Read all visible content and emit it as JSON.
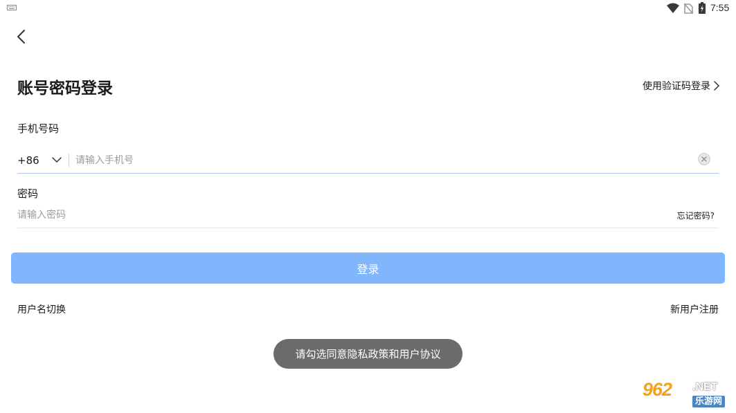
{
  "status_bar": {
    "time": "7:55",
    "icons": [
      "keyboard-icon",
      "wifi-icon",
      "no-sim-icon",
      "battery-charging-icon"
    ]
  },
  "header": {
    "back_icon": "chevron-left-icon",
    "title": "账号密码登录",
    "switch_label": "使用验证码登录"
  },
  "phone": {
    "label": "手机号码",
    "country_code": "+86",
    "placeholder": "请输入手机号",
    "value": ""
  },
  "password": {
    "label": "密码",
    "placeholder": "请输入密码",
    "value": "",
    "forgot_label": "忘记密码?"
  },
  "actions": {
    "login_label": "登录",
    "username_switch_label": "用户名切换",
    "register_label": "新用户注册"
  },
  "toast": {
    "message": "请勾选同意隐私政策和用户协议"
  },
  "watermark": {
    "number": "962",
    "suffix": ".NET",
    "site": "乐游网"
  },
  "colors": {
    "primary_button": "#7fb6fc",
    "toast_bg": "#6b6b6b",
    "active_underline": "#a9c8f5"
  }
}
